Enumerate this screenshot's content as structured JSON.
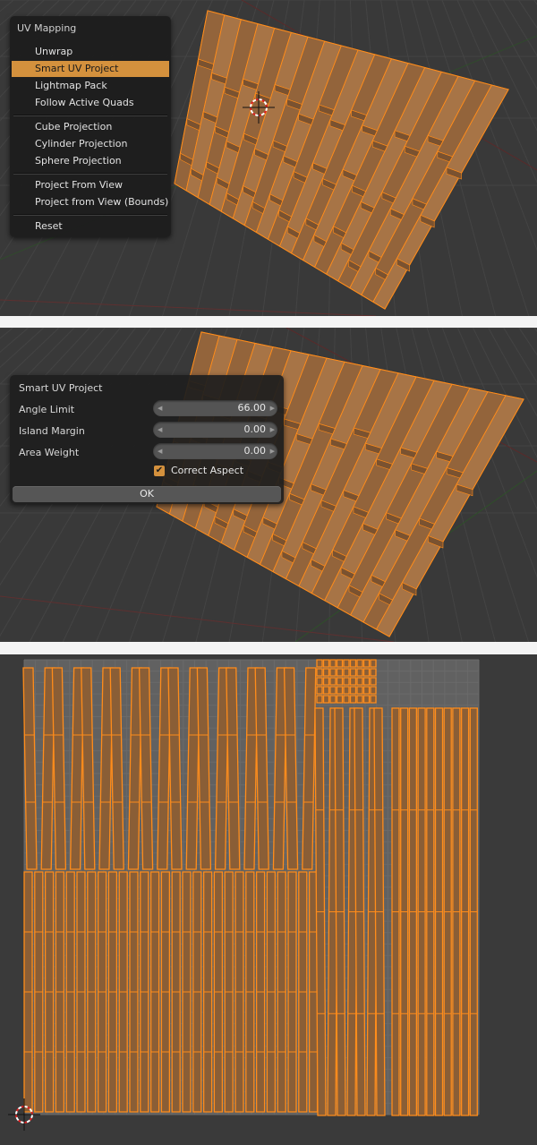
{
  "panel1": {
    "menu": {
      "title": "UV Mapping",
      "items": [
        {
          "label": "Unwrap"
        },
        {
          "label": "Smart UV Project",
          "active": true
        },
        {
          "label": "Lightmap Pack"
        },
        {
          "label": "Follow Active Quads"
        },
        {
          "label": "Cube Projection"
        },
        {
          "label": "Cylinder Projection"
        },
        {
          "label": "Sphere Projection"
        },
        {
          "label": "Project From View"
        },
        {
          "label": "Project from View (Bounds)"
        },
        {
          "label": "Reset"
        }
      ]
    }
  },
  "panel2": {
    "operator": {
      "title": "Smart UV Project",
      "angle_limit": {
        "label": "Angle Limit",
        "value": "66.00"
      },
      "island_margin": {
        "label": "Island Margin",
        "value": "0.00"
      },
      "area_weight": {
        "label": "Area Weight",
        "value": "0.00"
      },
      "correct_aspect": {
        "label": "Correct Aspect",
        "checked": true
      },
      "ok_label": "OK"
    }
  },
  "colors": {
    "mesh_face": "#9a6a3f",
    "mesh_edge": "#ff8c1a",
    "menu_highlight": "#d4913d",
    "viewport_bg": "#393939",
    "uv_grid_bg": "#616161"
  }
}
